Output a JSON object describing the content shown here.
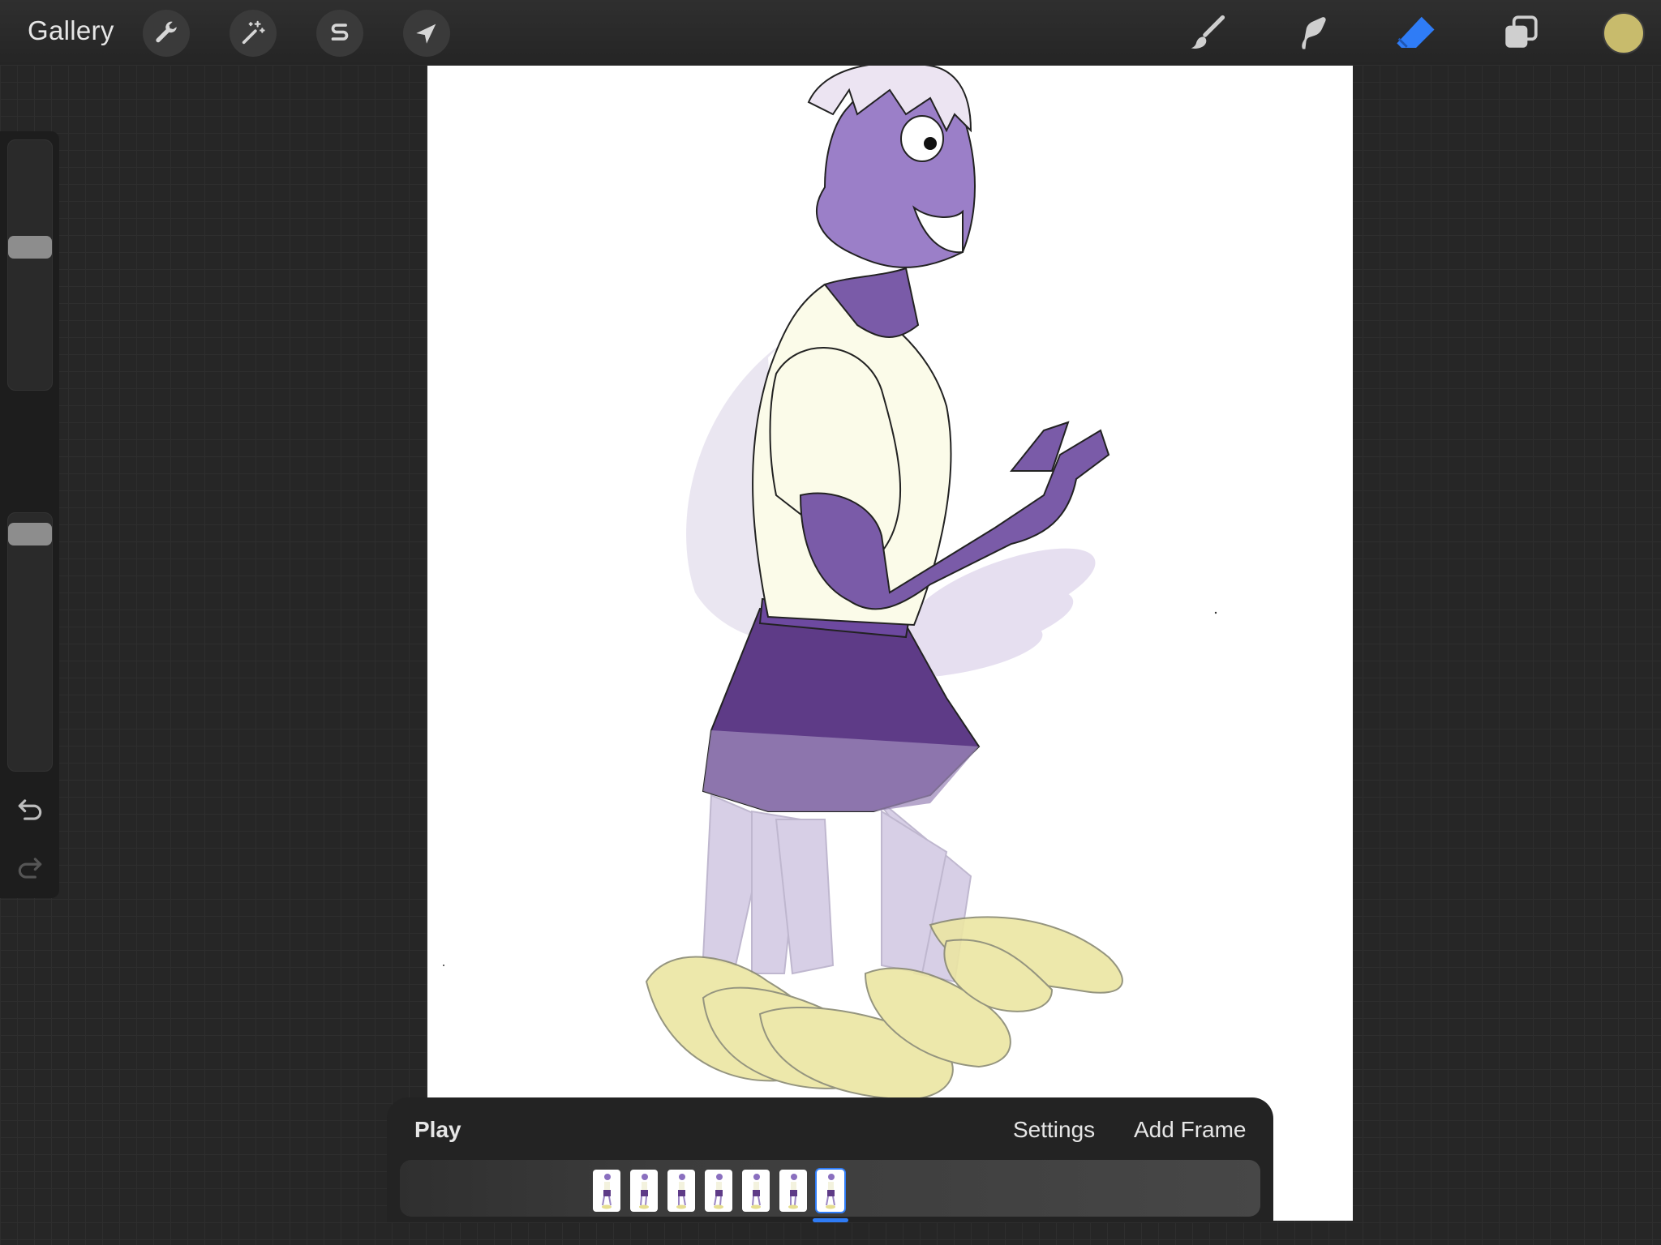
{
  "topbar": {
    "gallery_label": "Gallery",
    "left_tools": [
      {
        "icon": "wrench-icon",
        "name": "actions"
      },
      {
        "icon": "magic-wand-icon",
        "name": "adjustments"
      },
      {
        "icon": "selection-s-icon",
        "name": "selection"
      },
      {
        "icon": "arrow-cursor-icon",
        "name": "transform"
      }
    ],
    "right_tools": [
      {
        "icon": "brush-icon",
        "name": "paint"
      },
      {
        "icon": "smudge-icon",
        "name": "smudge"
      },
      {
        "icon": "eraser-icon",
        "name": "erase",
        "active": true
      },
      {
        "icon": "layers-icon",
        "name": "layers"
      }
    ],
    "current_color": "#c8bb6c",
    "active_tool_color": "#2f7cf6"
  },
  "sidebar": {
    "brush_size_level": 0.58,
    "opacity_level": 0.97,
    "undo_icon": "undo-icon",
    "redo_icon": "redo-icon",
    "modify_icon": "square-modify-icon"
  },
  "animation": {
    "play_label": "Play",
    "settings_label": "Settings",
    "add_frame_label": "Add Frame",
    "frame_count": 7,
    "selected_frame": 7,
    "indicator_color": "#2f7cf6"
  }
}
